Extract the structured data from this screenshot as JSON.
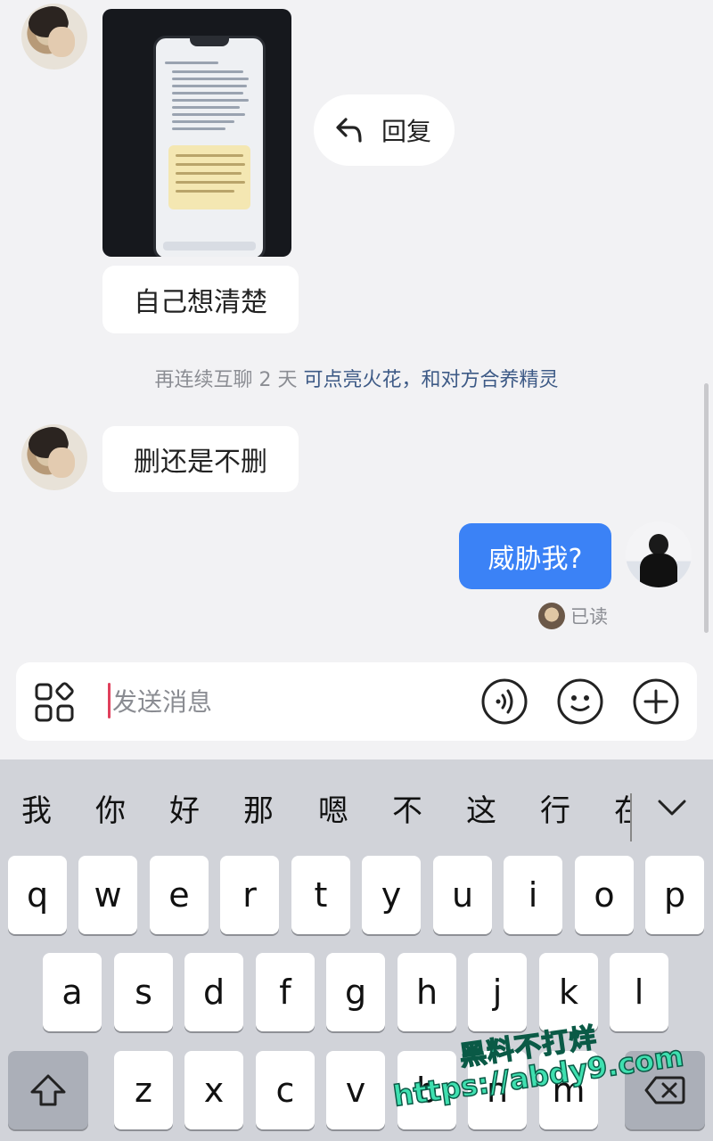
{
  "messages": {
    "reply_label": "回复",
    "msg_self_think": "自己想清楚",
    "msg_delete_or_not": "删还是不删",
    "msg_threaten": "威胁我?",
    "read_status": "已读"
  },
  "notice": {
    "prefix": "再连续互聊 2 天 ",
    "link": "可点亮火花，和对方合养精灵"
  },
  "input": {
    "placeholder": "发送消息"
  },
  "icons": {
    "apps": "apps-grid-icon",
    "voice": "voice-icon",
    "emoji": "emoji-icon",
    "plus": "plus-icon",
    "reply": "reply-arrow-icon",
    "shift": "shift-icon",
    "backspace": "backspace-icon",
    "collapse": "chevron-down-icon"
  },
  "keyboard": {
    "candidates": [
      "我",
      "你",
      "好",
      "那",
      "嗯",
      "不",
      "这",
      "行",
      "在"
    ],
    "row1": [
      "q",
      "w",
      "e",
      "r",
      "t",
      "y",
      "u",
      "i",
      "o",
      "p"
    ],
    "row2": [
      "a",
      "s",
      "d",
      "f",
      "g",
      "h",
      "j",
      "k",
      "l"
    ],
    "row3": [
      "z",
      "x",
      "c",
      "v",
      "b",
      "n",
      "m"
    ]
  },
  "watermark": {
    "line1": "黑料不打烊",
    "line2": "https://abdy9.com"
  },
  "colors": {
    "my_bubble": "#3b82f6",
    "link_text": "#3d5a86",
    "caret": "#e0405c",
    "watermark": "#3fe0b0"
  }
}
